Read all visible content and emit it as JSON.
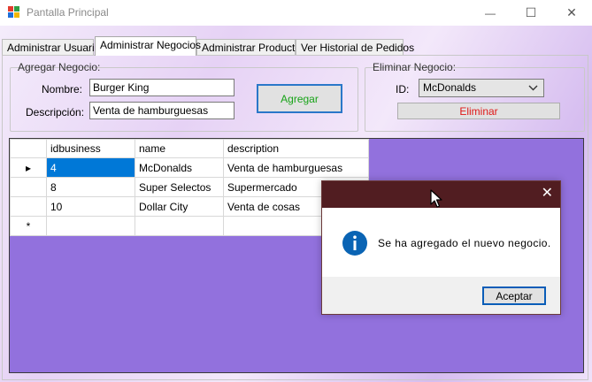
{
  "window": {
    "title": "Pantalla Principal",
    "minimize_glyph": "—",
    "maximize_glyph": "☐",
    "close_glyph": "✕"
  },
  "tabs": [
    {
      "label": "Administrar Usuarios"
    },
    {
      "label": "Administrar Negocios"
    },
    {
      "label": "Administrar Productos"
    },
    {
      "label": "Ver Historial de Pedidos"
    }
  ],
  "add_group": {
    "title": "Agregar Negocio:",
    "name_label": "Nombre:",
    "name_value": "Burger King",
    "desc_label": "Descripción:",
    "desc_value": "Venta de hamburguesas",
    "add_button": "Agregar"
  },
  "delete_group": {
    "title": "Eliminar Negocio:",
    "id_label": "ID:",
    "id_selected": "McDonalds",
    "delete_button": "Eliminar"
  },
  "grid": {
    "columns": [
      "idbusiness",
      "name",
      "description"
    ],
    "rows": [
      {
        "idbusiness": "4",
        "name": "McDonalds",
        "description": "Venta de hamburguesas"
      },
      {
        "idbusiness": "8",
        "name": "Super Selectos",
        "description": "Supermercado"
      },
      {
        "idbusiness": "10",
        "name": "Dollar City",
        "description": "Venta de cosas"
      }
    ],
    "current_row_marker": "▸",
    "new_row_marker": "*"
  },
  "dialog": {
    "message": "Se ha agregado el nuevo negocio.",
    "ok_button": "Aceptar",
    "close_glyph": "✕",
    "icon": "info-icon"
  },
  "colors": {
    "grid_background": "#9271dd",
    "dialog_titlebar": "#511d21",
    "selection": "#0078d7",
    "add_text": "#17a317",
    "delete_text": "#e01818",
    "info_blue": "#0a64b4"
  }
}
